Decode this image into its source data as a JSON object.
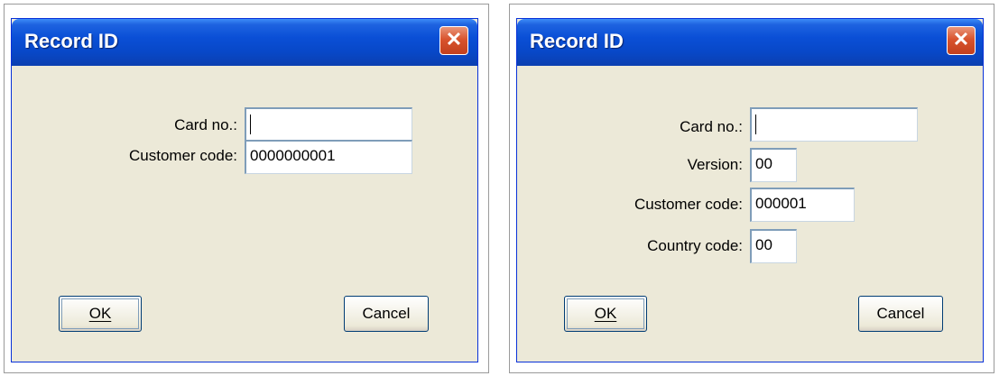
{
  "dialogs": [
    {
      "title": "Record ID",
      "close_glyph": "✕",
      "fields": [
        {
          "label": "Card no.:",
          "value": ""
        },
        {
          "label": "Customer code:",
          "value": "0000000001"
        }
      ],
      "ok_label": "OK",
      "cancel_label": "Cancel"
    },
    {
      "title": "Record ID",
      "close_glyph": "✕",
      "fields": [
        {
          "label": "Card no.:",
          "value": ""
        },
        {
          "label": "Version:",
          "value": "00"
        },
        {
          "label": "Customer code:",
          "value": "000001"
        },
        {
          "label": "Country code:",
          "value": "00"
        }
      ],
      "ok_label": "OK",
      "cancel_label": "Cancel"
    }
  ],
  "colors": {
    "titlebar": "#0a4fd6",
    "dialog_face": "#ece9d8",
    "close_button": "#d9542e"
  }
}
